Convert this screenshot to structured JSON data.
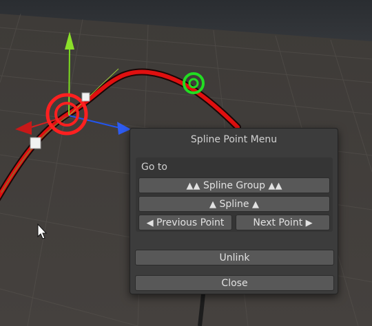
{
  "menu": {
    "title": "Spline Point Menu",
    "goto_label": "Go to",
    "spline_group": {
      "arrow_left": "▲▲",
      "label": "Spline Group",
      "arrow_right": "▲▲"
    },
    "spline": {
      "arrow_left": "▲",
      "label": "Spline",
      "arrow_right": "▲"
    },
    "previous": {
      "arrow": "◀",
      "label": "Previous Point"
    },
    "next": {
      "label": "Next Point",
      "arrow": "▶"
    },
    "unlink_label": "Unlink",
    "close_label": "Close"
  },
  "colors": {
    "spline": "#e01010",
    "selected_point": "#ff2020",
    "other_point": "#22dd22",
    "axis_y": "#7ddc1f",
    "axis_x": "#d42020",
    "axis_z": "#2255ee",
    "menu_bg": "#3c3c3c",
    "button_bg": "#585858"
  },
  "icons": [
    "mouse-cursor-icon",
    "arrow-up-icon",
    "arrow-left-icon",
    "arrow-right-icon"
  ]
}
